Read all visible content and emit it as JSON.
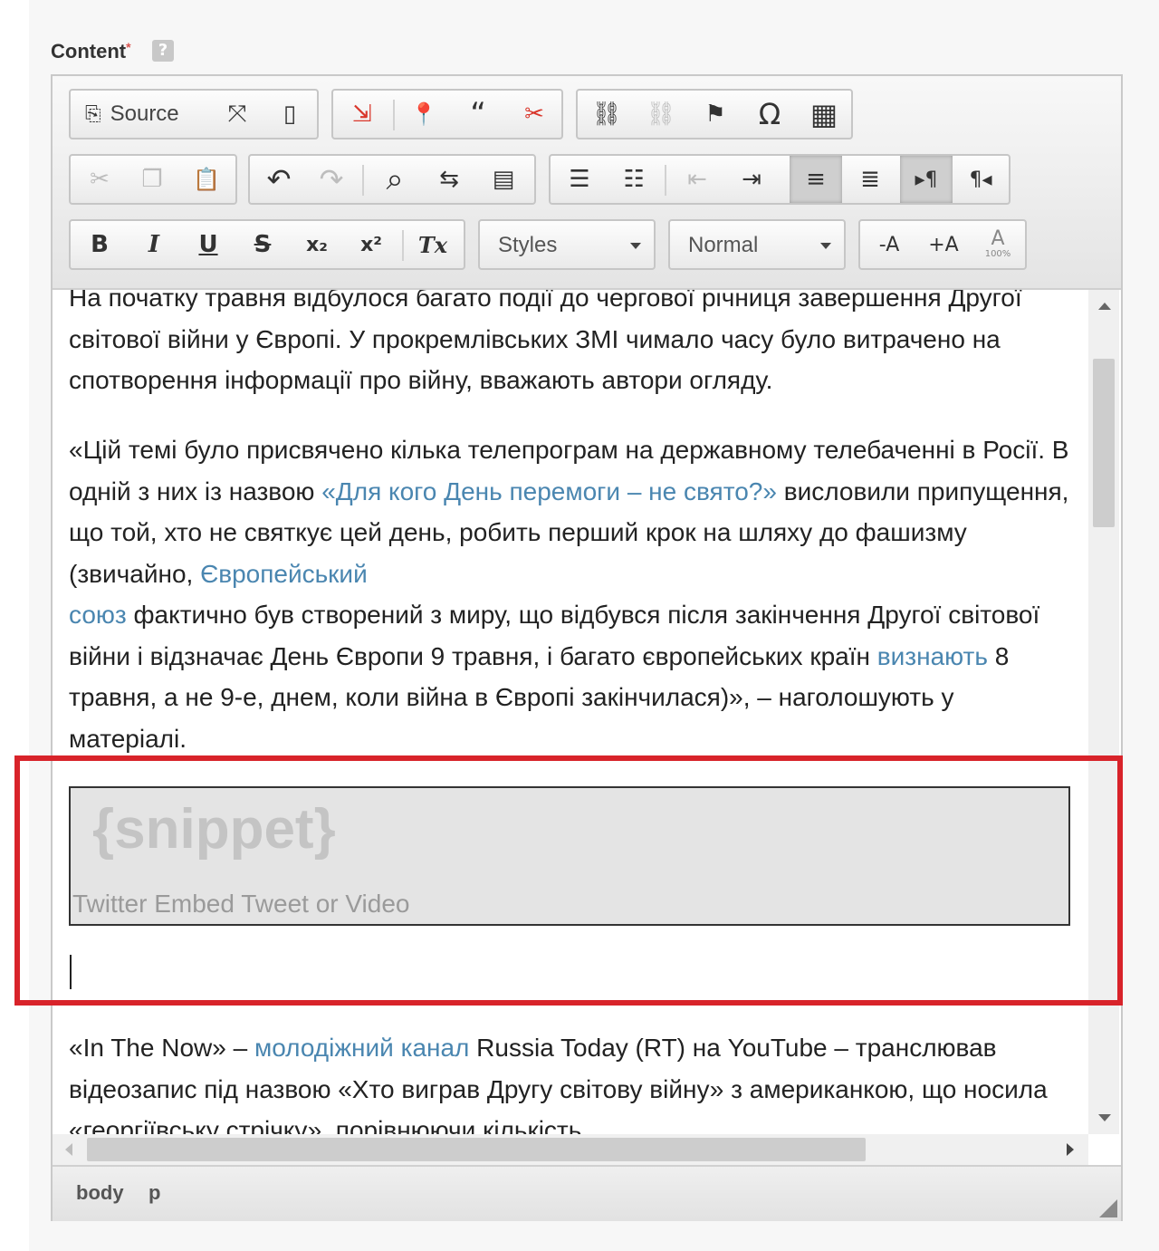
{
  "form": {
    "label": "Content",
    "required_mark": "*",
    "help_glyph": "?"
  },
  "toolbar": {
    "source_label": "Source",
    "styles_value": "Styles",
    "format_value": "Normal",
    "icons": {
      "source": "⎘",
      "maximize": "⤧",
      "showblocks": "▯",
      "import": "⇲",
      "location": "📍",
      "quote": "“",
      "snippet_remove": "✂",
      "link": "⛓",
      "unlink": "⛓",
      "flag": "⚑",
      "omega": "Ω",
      "table": "▦",
      "cut": "✂",
      "copy": "❐",
      "paste": "📋",
      "undo": "↶",
      "redo": "↷",
      "find": "⌕",
      "replace": "⇆",
      "selectall": "▤",
      "numbered_list": "☰",
      "bulleted_list": "☷",
      "outdent": "⇤",
      "indent": "⇥",
      "align_left": "≡",
      "align_right": "≣",
      "ltr": "▸¶",
      "rtl": "¶◂",
      "bold": "B",
      "italic": "I",
      "underline": "U",
      "strike": "S",
      "subscript": "x₂",
      "superscript": "x²",
      "remove_format": "Tx",
      "zoom_out": "-A",
      "zoom_in": "+A",
      "zoom_reset": "A"
    },
    "zoom_reset_caption": "100%"
  },
  "content": {
    "p1": "На початку травня відбулося багато події до чергової річниця завершення Другої світової війни у Європі. У прокремлівських ЗМІ чимало часу було витрачено на спотворення інформації про війну, вважають автори огляду.",
    "p2_a": "«Цій темі було присвячено кілька телепрограм на державному телебаченні в Росії. В одній з них із назвою ",
    "p2_link1": "«Для кого День перемоги – не свято?»",
    "p2_b": " висловили припущення, що той, хто не святкує цей день, робить перший крок на шляху до фашизму (звичайно, ",
    "p2_link2a": "Європейський",
    "p2_link2b": "союз",
    "p2_c": " фактично був створений з миру, що відбувся після закінчення Другої світової війни і відзначає День Європи 9 травня, і багато європейських країн ",
    "p2_link3": "визнають",
    "p2_d": " 8 травня, а не 9-е, днем, коли війна в Європі закінчилася)», – наголошують у матеріалі.",
    "snippet_title": "{snippet}",
    "snippet_desc": "Twitter Embed Tweet or Video",
    "p3_a": "«In The Now» – ",
    "p3_link": "молодіжний канал",
    "p3_b": " Russia Today (RT) на YouTube – транслював відеозапис під назвою «Хто виграв Другу світову війну» з американкою, що носила «георгіївську стрічку», порівнюючи кількість"
  },
  "status": {
    "path": [
      "body",
      "p"
    ]
  },
  "colors": {
    "link": "#4a86b0",
    "highlight": "#d8232a"
  }
}
